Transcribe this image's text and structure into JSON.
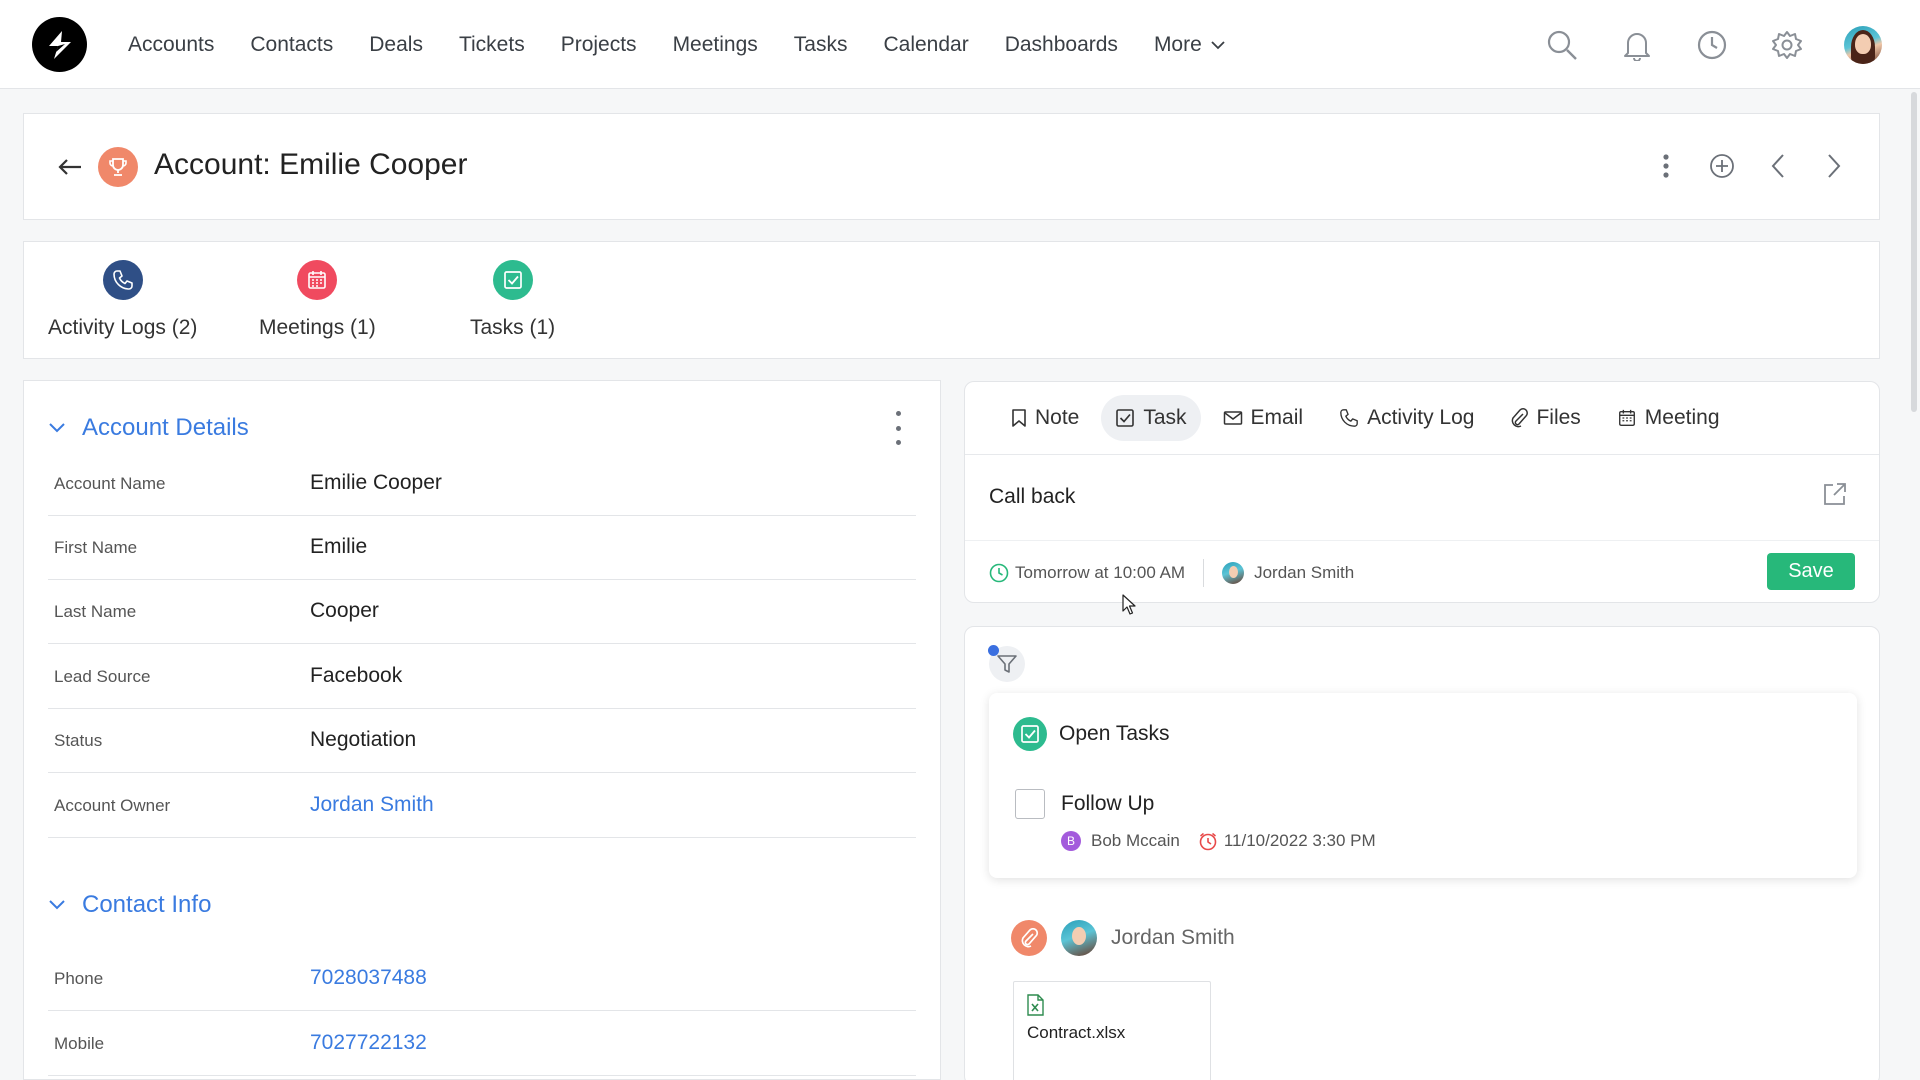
{
  "nav": {
    "links": [
      "Accounts",
      "Contacts",
      "Deals",
      "Tickets",
      "Projects",
      "Meetings",
      "Tasks",
      "Calendar",
      "Dashboards"
    ],
    "more_label": "More",
    "icons": [
      "search-icon",
      "bell-icon",
      "clock-icon",
      "gear-icon",
      "avatar"
    ]
  },
  "header": {
    "title": "Account: Emilie Cooper",
    "icon": "trophy-icon"
  },
  "related": [
    {
      "label": "Activity Logs (2)",
      "icon": "phone-icon",
      "color": "#2f4f86"
    },
    {
      "label": "Meetings (1)",
      "icon": "calendar-icon",
      "color": "#f04a5f"
    },
    {
      "label": "Tasks (1)",
      "icon": "check-square-icon",
      "color": "#2dbb8f"
    }
  ],
  "details": {
    "section_title": "Account Details",
    "fields": [
      {
        "label": "Account Name",
        "value": "Emilie Cooper"
      },
      {
        "label": "First Name",
        "value": "Emilie"
      },
      {
        "label": "Last Name",
        "value": "Cooper"
      },
      {
        "label": "Lead Source",
        "value": "Facebook"
      },
      {
        "label": "Status",
        "value": "Negotiation"
      },
      {
        "label": "Account Owner",
        "value": "Jordan Smith"
      }
    ],
    "contact_title": "Contact Info",
    "contact_fields": [
      {
        "label": "Phone",
        "value": "7028037488"
      },
      {
        "label": "Mobile",
        "value": "7027722132"
      }
    ]
  },
  "composer": {
    "tabs": [
      "Note",
      "Task",
      "Email",
      "Activity Log",
      "Files",
      "Meeting"
    ],
    "active_tab": "Task",
    "input_value": "Call back",
    "due": "Tomorrow at 10:00 AM",
    "assignee": "Jordan Smith",
    "save_label": "Save"
  },
  "timeline": {
    "open_tasks_title": "Open Tasks",
    "task": {
      "name": "Follow Up",
      "assignee_initial": "B",
      "assignee": "Bob Mccain",
      "due": "11/10/2022 3:30 PM"
    },
    "feed_user": "Jordan Smith",
    "file_name": "Contract.xlsx"
  },
  "colors": {
    "accent": "#3a7be0",
    "save": "#27b87a",
    "overdue": "#e84a4a"
  }
}
